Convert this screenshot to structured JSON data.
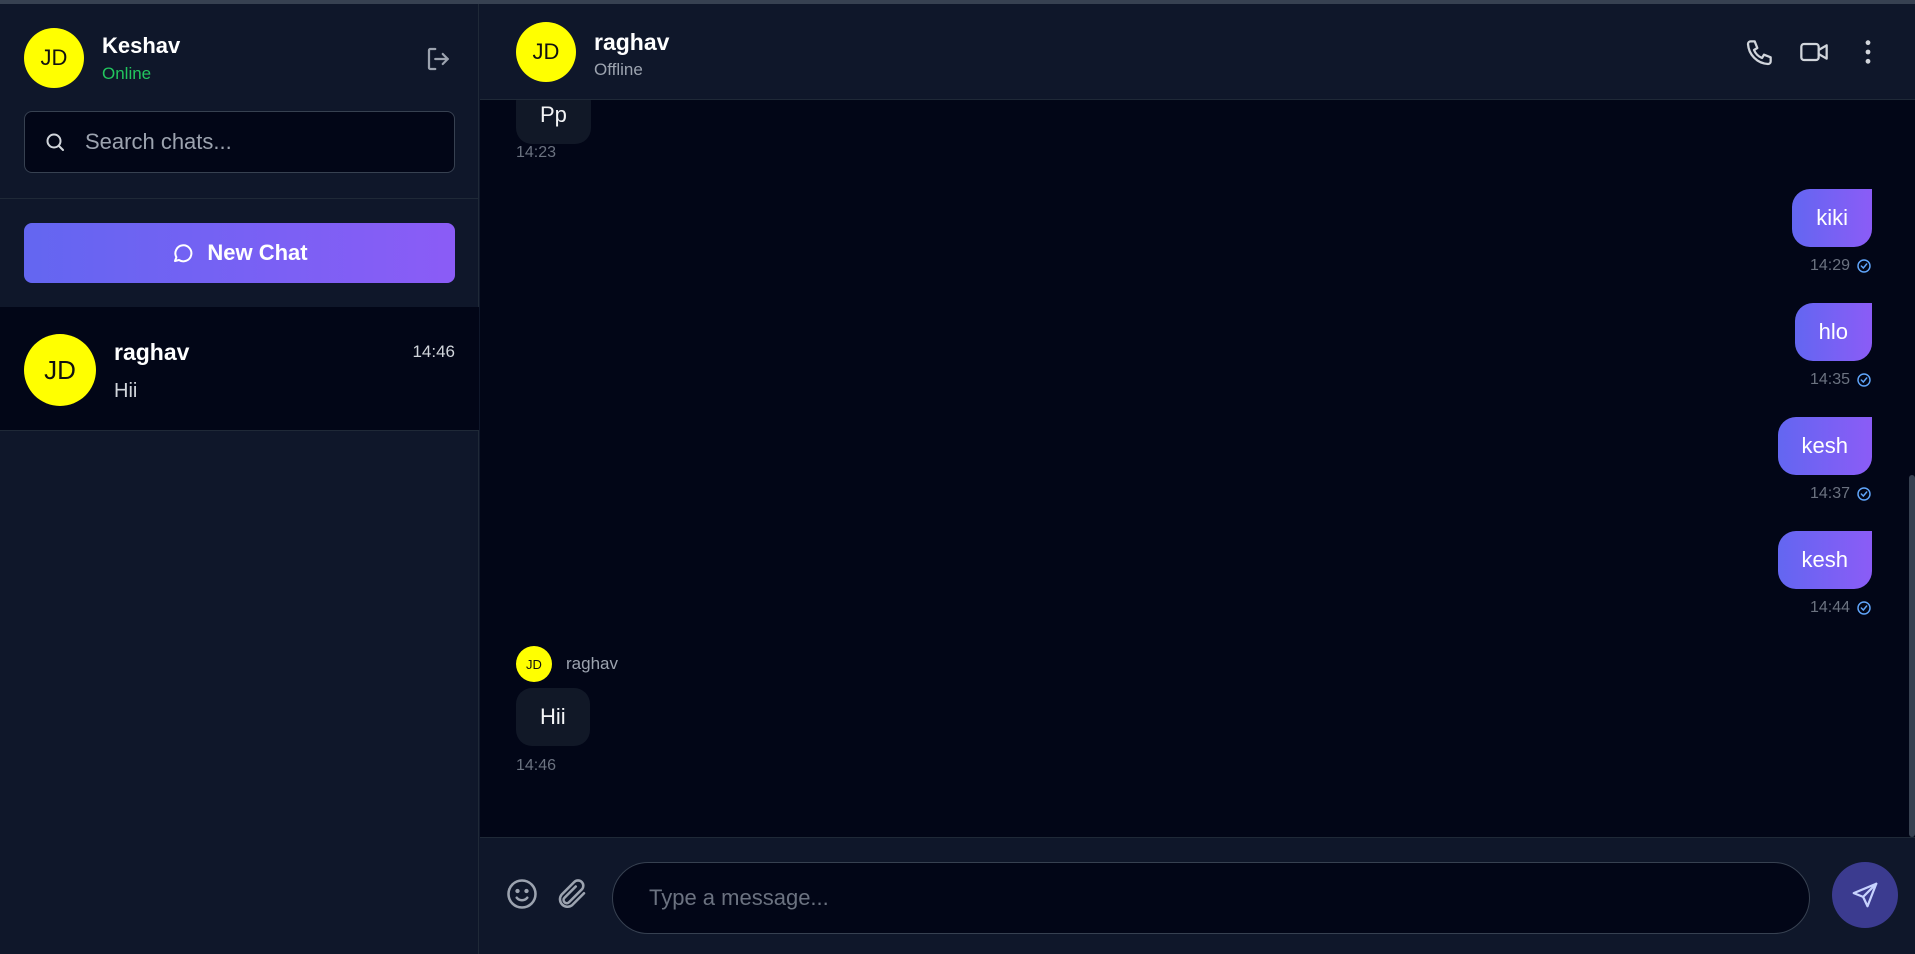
{
  "current_user": {
    "initials": "JD",
    "name": "Keshav",
    "status": "Online"
  },
  "search": {
    "placeholder": "Search chats..."
  },
  "new_chat_label": "New Chat",
  "chat_list": [
    {
      "initials": "JD",
      "name": "raghav",
      "time": "14:46",
      "preview": "Hii"
    }
  ],
  "active_chat": {
    "initials": "JD",
    "name": "raghav",
    "status": "Offline"
  },
  "messages": [
    {
      "direction": "in",
      "text": "Pp",
      "time": "14:23"
    },
    {
      "direction": "out",
      "text": "kiki",
      "time": "14:29"
    },
    {
      "direction": "out",
      "text": "hlo",
      "time": "14:35"
    },
    {
      "direction": "out",
      "text": "kesh",
      "time": "14:37"
    },
    {
      "direction": "out",
      "text": "kesh",
      "time": "14:44"
    },
    {
      "direction": "in",
      "sender_initials": "JD",
      "sender": "raghav",
      "text": "Hii",
      "time": "14:46"
    }
  ],
  "composer": {
    "placeholder": "Type a message..."
  },
  "colors": {
    "accent_start": "#6366f1",
    "accent_end": "#8b5cf6",
    "online": "#22c55e",
    "avatar": "#ffff00"
  }
}
